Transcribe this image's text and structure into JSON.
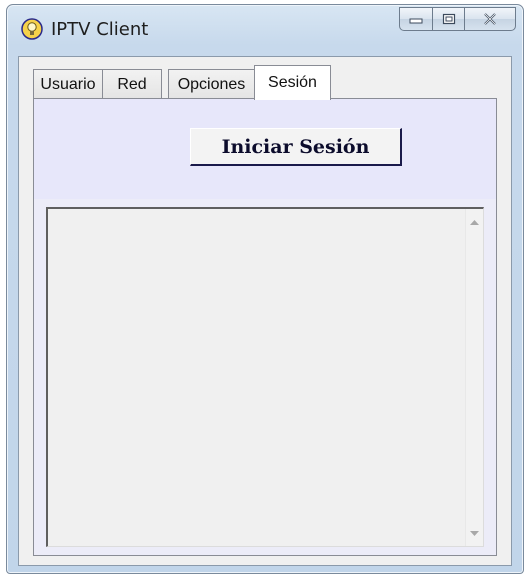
{
  "window": {
    "title": "IPTV Client",
    "icon": "lightbulb-icon",
    "controls": [
      "minimize-icon",
      "maximize-icon",
      "close-icon"
    ]
  },
  "tabs": [
    {
      "label": "Usuario",
      "active": false
    },
    {
      "label": "Red",
      "active": false
    },
    {
      "label": "Opciones",
      "active": false
    },
    {
      "label": "Sesión",
      "active": true
    }
  ],
  "session": {
    "login_button_label": "Iniciar Sesión",
    "log_text": ""
  },
  "colors": {
    "panel_background": "#e7e7fa",
    "button_border": "#1a1a4a"
  }
}
